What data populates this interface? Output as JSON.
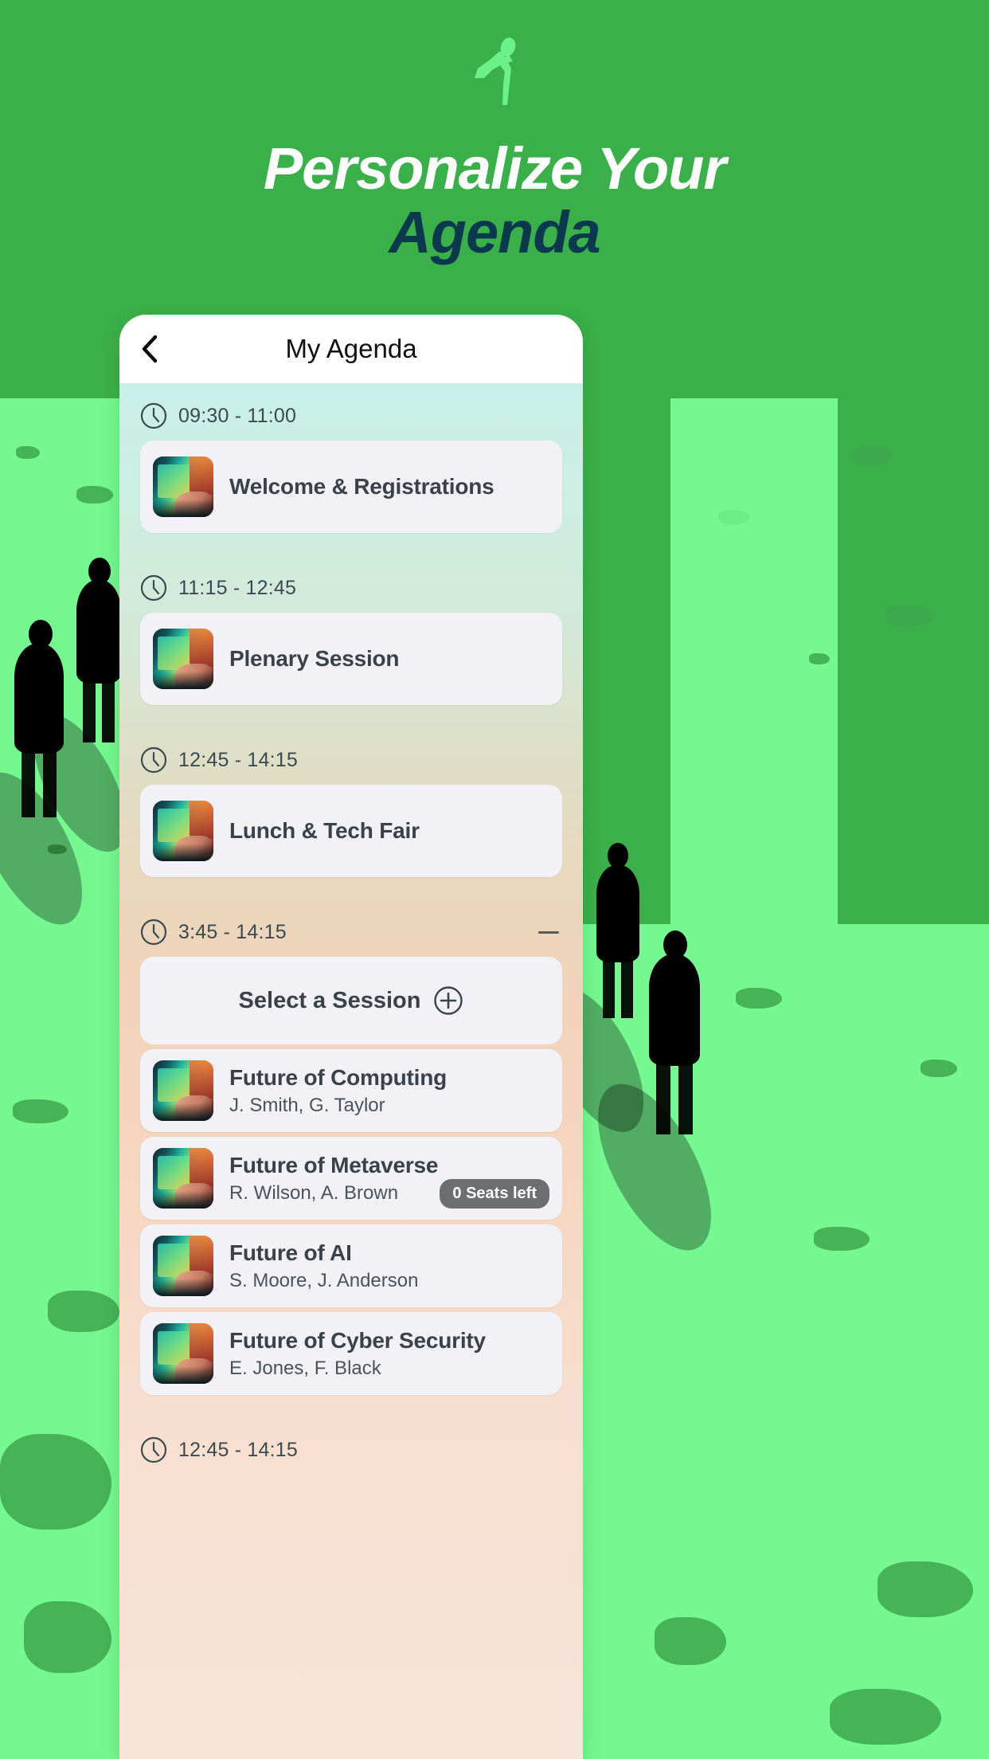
{
  "hero": {
    "logo_icon": "running-person-icon",
    "title_line1": "Personalize Your",
    "title_line2": "Agenda",
    "brand_green": "#3bb04a",
    "brand_light_green": "#74f88f",
    "brand_navy": "#0b3a4e"
  },
  "phone": {
    "appbar": {
      "back_icon": "chevron-left-icon",
      "title": "My Agenda"
    },
    "slots": [
      {
        "clock_icon": "clock-icon",
        "time": "09:30 - 11:00",
        "collapsible": false,
        "items": [
          {
            "thumb_icon": "session-thumbnail",
            "title": "Welcome & Registrations",
            "subtitle": "",
            "badge": ""
          }
        ]
      },
      {
        "clock_icon": "clock-icon",
        "time": "11:15 - 12:45",
        "collapsible": false,
        "items": [
          {
            "thumb_icon": "session-thumbnail",
            "title": "Plenary Session",
            "subtitle": "",
            "badge": ""
          }
        ]
      },
      {
        "clock_icon": "clock-icon",
        "time": "12:45 - 14:15",
        "collapsible": false,
        "items": [
          {
            "thumb_icon": "session-thumbnail",
            "title": "Lunch & Tech Fair",
            "subtitle": "",
            "badge": ""
          }
        ]
      },
      {
        "clock_icon": "clock-icon",
        "time": "3:45 - 14:15",
        "collapsible": true,
        "collapse_icon": "minus-icon",
        "select_label": "Select a Session",
        "select_icon": "plus-circle-icon",
        "items": [
          {
            "thumb_icon": "session-thumbnail",
            "title": "Future of Computing",
            "subtitle": "J. Smith, G. Taylor",
            "badge": ""
          },
          {
            "thumb_icon": "session-thumbnail",
            "title": "Future of Metaverse",
            "subtitle": "R. Wilson, A. Brown",
            "badge": "0 Seats left"
          },
          {
            "thumb_icon": "session-thumbnail",
            "title": "Future of AI",
            "subtitle": "S. Moore, J. Anderson",
            "badge": ""
          },
          {
            "thumb_icon": "session-thumbnail",
            "title": "Future of Cyber Security",
            "subtitle": "E. Jones, F. Black",
            "badge": ""
          }
        ]
      },
      {
        "clock_icon": "clock-icon",
        "time": "12:45 - 14:15",
        "collapsible": false,
        "items": []
      }
    ]
  }
}
